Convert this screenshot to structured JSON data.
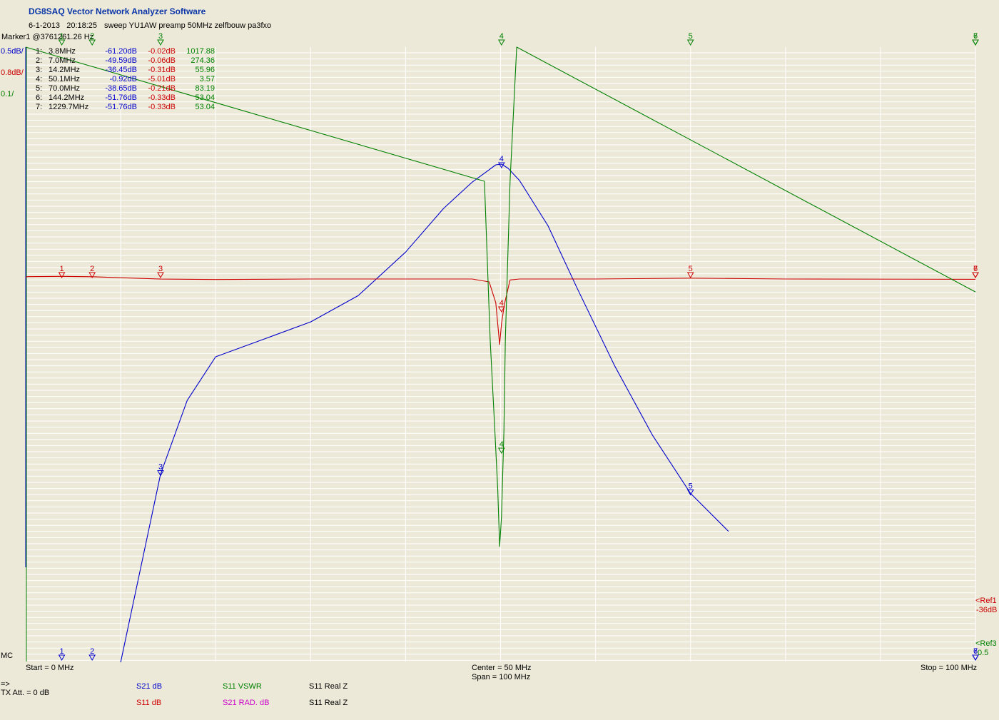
{
  "app_title": "DG8SAQ Vector Network Analyzer Software",
  "header": {
    "date": "6-1-2013",
    "time": "20:18:25",
    "sweep_description": "sweep YU1AW preamp 50MHz zelfbouw pa3fxo"
  },
  "marker_readout": "Marker1 @3761261.26 Hz",
  "scales": {
    "s21": "0.5dB/",
    "s11": "0.8dB/",
    "vswr": "0.1/"
  },
  "marker_table": [
    {
      "id": "1:",
      "freq": "3.8MHz",
      "s21": "-61.20dB",
      "s11": "-0.02dB",
      "vswr": "1017.88"
    },
    {
      "id": "2:",
      "freq": "7.0MHz",
      "s21": "-49.59dB",
      "s11": "-0.06dB",
      "vswr": "274.36"
    },
    {
      "id": "3:",
      "freq": "14.2MHz",
      "s21": "-36.45dB",
      "s11": "-0.31dB",
      "vswr": "55.96"
    },
    {
      "id": "4:",
      "freq": "50.1MHz",
      "s21": "-0.92dB",
      "s11": "-5.01dB",
      "vswr": "3.57"
    },
    {
      "id": "5:",
      "freq": "70.0MHz",
      "s21": "-38.65dB",
      "s11": "-0.21dB",
      "vswr": "83.19"
    },
    {
      "id": "6:",
      "freq": "144.2MHz",
      "s21": "-51.76dB",
      "s11": "-0.33dB",
      "vswr": "53.04"
    },
    {
      "id": "7:",
      "freq": "1229.7MHz",
      "s21": "-51.76dB",
      "s11": "-0.33dB",
      "vswr": "53.04"
    }
  ],
  "footer": {
    "mc": "MC",
    "start": "Start = 0 MHz",
    "center": "Center = 50 MHz",
    "span": "Span = 100 MHz",
    "stop": "Stop = 100 MHz",
    "arrow": "=>",
    "tx_att": "TX Att.  = 0 dB"
  },
  "trace_labels": {
    "s21_db": "S21  dB",
    "s11_db": "S11  dB",
    "s11_vswr": "S11  VSWR",
    "s21_rad": "S21  RAD. dB",
    "s11_realz_1": "S11  Real Z",
    "s11_realz_2": "S11  Real Z"
  },
  "refs": {
    "ref1": "<Ref1",
    "ref1_value": "-36dB",
    "ref3": "<Ref3",
    "ref3_value": "0.5"
  },
  "colors": {
    "s21": "#0000cc",
    "s11": "#cc0000",
    "vswr": "#008000",
    "s21_rad": "#cc00cc",
    "grid": "#ffffff",
    "background": "#ece9d8"
  },
  "chart_data": {
    "type": "line",
    "x_unit": "MHz",
    "xlim": [
      0,
      100
    ],
    "grid": true,
    "series": [
      {
        "name": "S21 dB",
        "color": "#0000cc",
        "x": [
          10,
          14.2,
          17,
          20,
          25,
          30,
          35,
          40,
          44,
          47,
          48.5,
          49.5,
          50.1,
          50.8,
          52,
          55,
          58,
          62,
          66,
          70,
          74
        ],
        "y": [
          -58,
          -36.45,
          -28,
          -23,
          -21,
          -19,
          -16,
          -11,
          -6,
          -3,
          -1.8,
          -1.0,
          -0.92,
          -1.4,
          -2.8,
          -8,
          -15,
          -24,
          -32,
          -38.65,
          -43
        ]
      },
      {
        "name": "S11 dB",
        "color": "#cc0000",
        "x": [
          0,
          0.2,
          3.8,
          7.0,
          14.2,
          20,
          30,
          40,
          47,
          48.8,
          49.5,
          49.9,
          50.1,
          50.4,
          51,
          52,
          60,
          70,
          80,
          100
        ],
        "y": [
          -0.1,
          -0.05,
          -0.02,
          -0.06,
          -0.31,
          -0.35,
          -0.3,
          -0.3,
          -0.3,
          -0.6,
          -2.8,
          -7.2,
          -5.01,
          -3.0,
          -0.4,
          -0.3,
          -0.3,
          -0.21,
          -0.3,
          -0.33
        ]
      },
      {
        "name": "S11 VSWR",
        "color": "#008000",
        "x": [
          0,
          48.3,
          48.9,
          49.4,
          49.7,
          49.9,
          50.1,
          50.35,
          50.5,
          51.0,
          51.7,
          100
        ],
        "y": [
          1017.88,
          200,
          30,
          10,
          5,
          2.5,
          3.57,
          10,
          30,
          200,
          1000,
          53.04
        ]
      }
    ],
    "markers": [
      {
        "id": 1,
        "freq_mhz": 3.8
      },
      {
        "id": 2,
        "freq_mhz": 7.0
      },
      {
        "id": 3,
        "freq_mhz": 14.2
      },
      {
        "id": 4,
        "freq_mhz": 50.1
      },
      {
        "id": 5,
        "freq_mhz": 70.0
      },
      {
        "id": 6,
        "freq_mhz": 144.2
      },
      {
        "id": 7,
        "freq_mhz": 1229.7
      }
    ]
  }
}
